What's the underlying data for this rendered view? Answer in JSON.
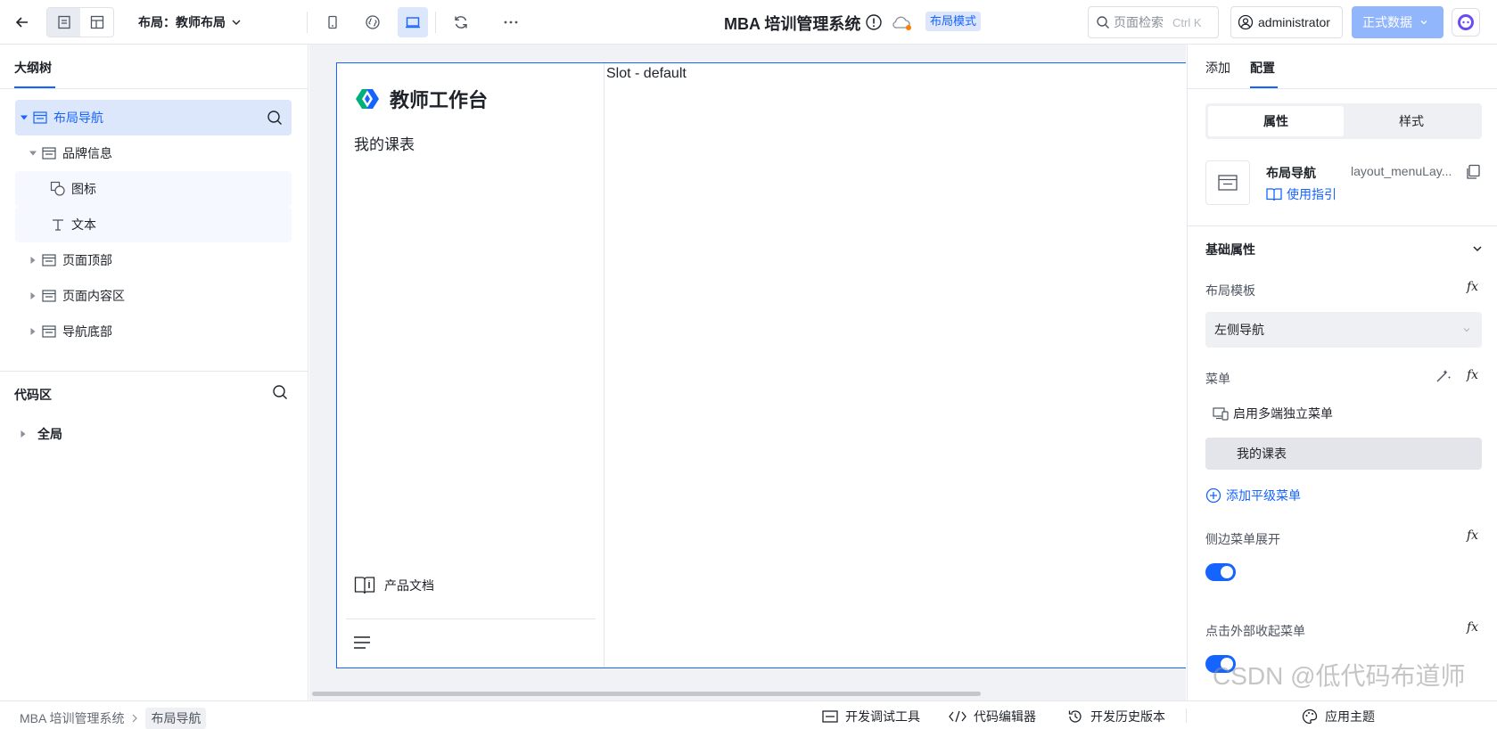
{
  "topbar": {
    "layout_selector": "布局：教师布局",
    "app_title": "MBA 培训管理系统",
    "mode_badge": "布局模式",
    "search_placeholder": "页面检索",
    "search_shortcut": "Ctrl K",
    "user": "administrator",
    "data_env": "正式数据"
  },
  "outline": {
    "tab": "大纲树",
    "nodes": [
      {
        "label": "布局导航"
      },
      {
        "label": "品牌信息"
      },
      {
        "label": "图标"
      },
      {
        "label": "文本"
      },
      {
        "label": "页面顶部"
      },
      {
        "label": "页面内容区"
      },
      {
        "label": "导航底部"
      }
    ]
  },
  "code_area": {
    "title": "代码区",
    "global": "全局"
  },
  "canvas": {
    "brand": "教师工作台",
    "menu_item": "我的课表",
    "slot": "Slot - default",
    "docs": "产品文档"
  },
  "inspector": {
    "tabs": {
      "add": "添加",
      "config": "配置"
    },
    "segments": {
      "props": "属性",
      "style": "样式"
    },
    "component_name": "布局导航",
    "component_id": "layout_menuLay...",
    "guide": "使用指引",
    "section": "基础属性",
    "layout_template_label": "布局模板",
    "layout_template_value": "左侧导航",
    "menu_label": "菜单",
    "multi_menu": "启用多端独立菜单",
    "menu_chip": "我的课表",
    "add_menu": "添加平级菜单",
    "side_expand_label": "侧边菜单展开",
    "click_collapse_label": "点击外部收起菜单",
    "fx": "fx"
  },
  "statusbar": {
    "crumb_root": "MBA 培训管理系统",
    "crumb_current": "布局导航",
    "dev_tools": "开发调试工具",
    "code_editor": "代码编辑器",
    "history": "开发历史版本",
    "theme": "应用主题"
  },
  "watermark": "CSDN @低代码布道师",
  "colors": {
    "accent": "#1664ff",
    "selected_bg": "#dde7fb",
    "data_btn": "#92b6fb"
  }
}
